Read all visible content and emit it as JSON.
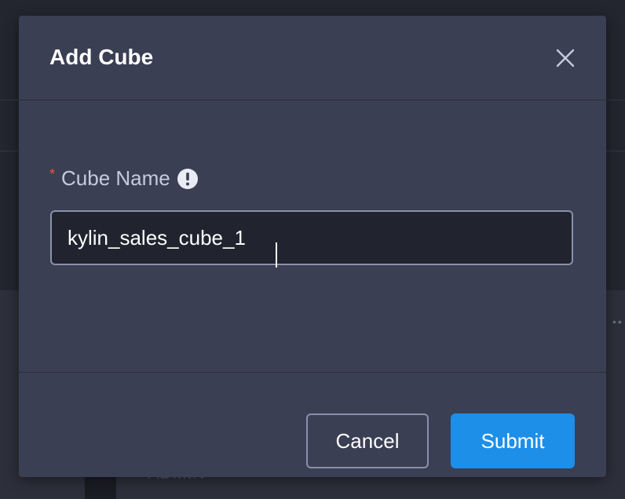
{
  "background": {
    "admin_label": "ADMIN",
    "more_glyph": "••"
  },
  "modal": {
    "title": "Add Cube",
    "close_icon": "close-icon",
    "field": {
      "required_mark": "*",
      "label": "Cube Name",
      "info_icon": "exclamation-circle-icon",
      "value": "kylin_sales_cube_1"
    },
    "buttons": {
      "cancel_label": "Cancel",
      "submit_label": "Submit"
    }
  },
  "colors": {
    "modal_bg": "#3a3f53",
    "submit_accent": "#1e8fe8",
    "required_star": "#f0533a",
    "input_bg": "#21232e",
    "input_border": "#8b90ad"
  }
}
